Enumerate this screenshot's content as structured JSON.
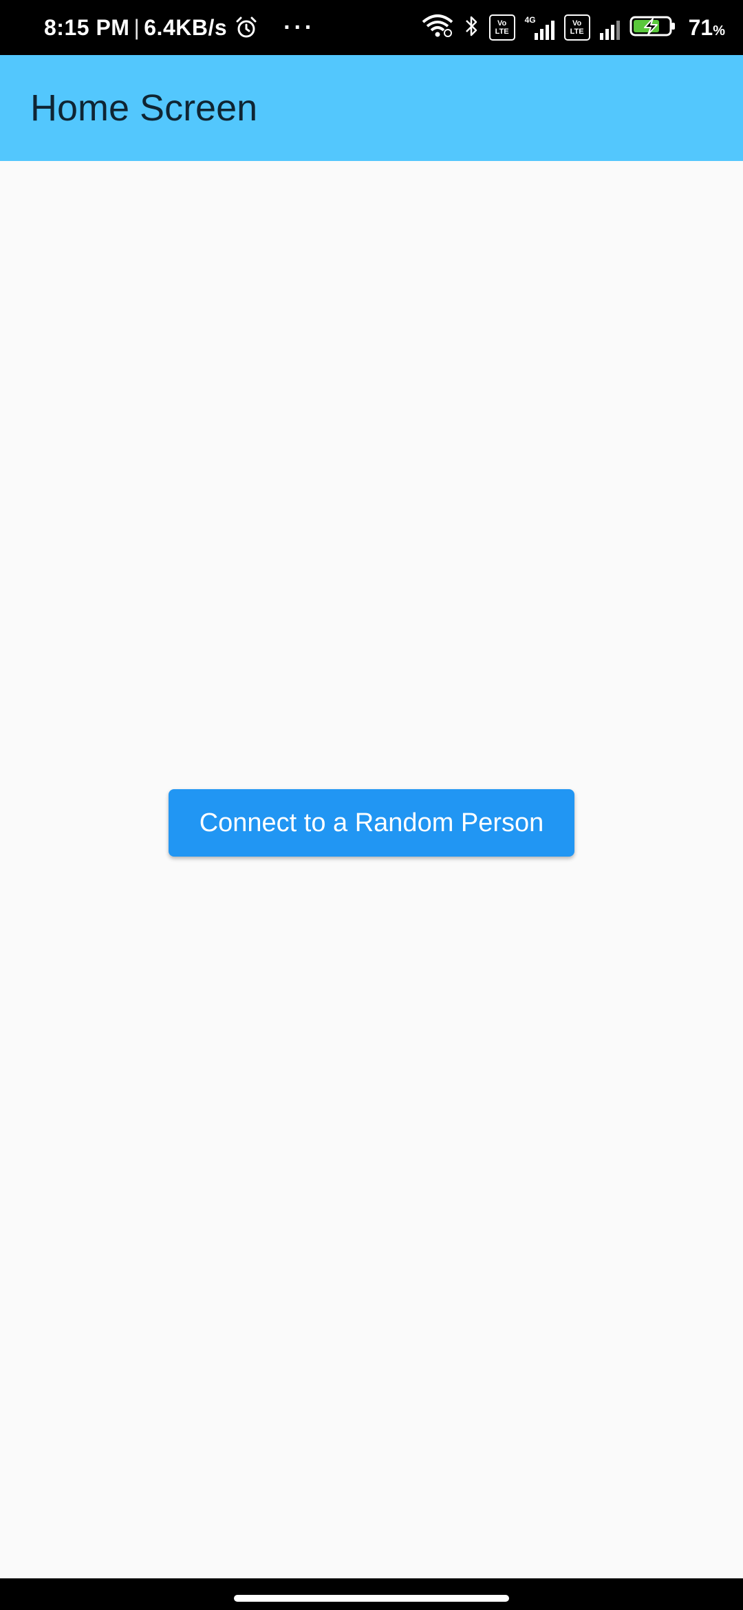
{
  "status_bar": {
    "time": "8:15 PM",
    "separator": "|",
    "net_speed": "6.4KB/s",
    "alarm_icon": "alarm-clock-icon",
    "more_notifications": "···",
    "network_4g": "4G",
    "volte_label_top": "Vo",
    "volte_label_bottom": "LTE",
    "battery_percent": "71",
    "battery_unit": "%"
  },
  "app_bar": {
    "title": "Home Screen",
    "color": "#53c7fd"
  },
  "main": {
    "connect_button_label": "Connect to a Random Person",
    "button_color": "#2196f3"
  }
}
